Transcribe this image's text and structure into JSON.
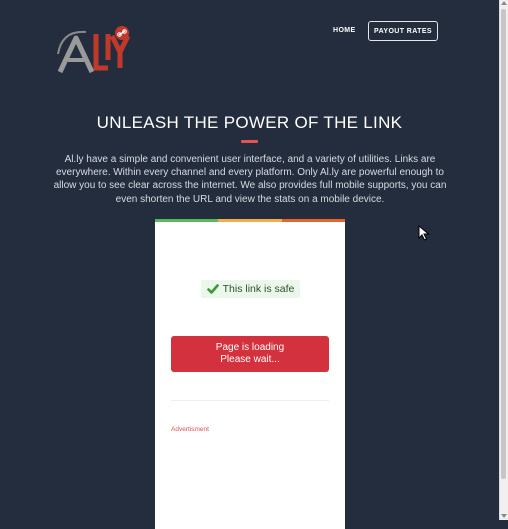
{
  "header": {
    "logo": {
      "icon": "ally-logo",
      "tagline": ""
    },
    "nav": {
      "home_label": "HOME",
      "payout_label": "PAYOUT RATES"
    }
  },
  "hero": {
    "title": "UNLEASH THE POWER OF THE LINK",
    "description": "Al.ly have a simple and convenient user interface, and a variety of utilities. Links are everywhere. Within every channel and every platform. Only Al.ly are powerful enough to allow you to see clear across the internet. We also provides full mobile supports, you can even shorten the URL and view the stats on a mobile device."
  },
  "card": {
    "stripe_colors": [
      "#5cb85c",
      "#f0ad4e",
      "#e8622c"
    ],
    "safe_text": "This link is safe",
    "loading_line1": "Page is loading",
    "loading_line2": "Please wait...",
    "ad_label": "Advertisment"
  },
  "colors": {
    "background": "#242d3d",
    "accent": "#e55353",
    "button": "#d2313d",
    "safe_bg": "#eaf7ea",
    "safe_icon": "#3a9a3a"
  }
}
